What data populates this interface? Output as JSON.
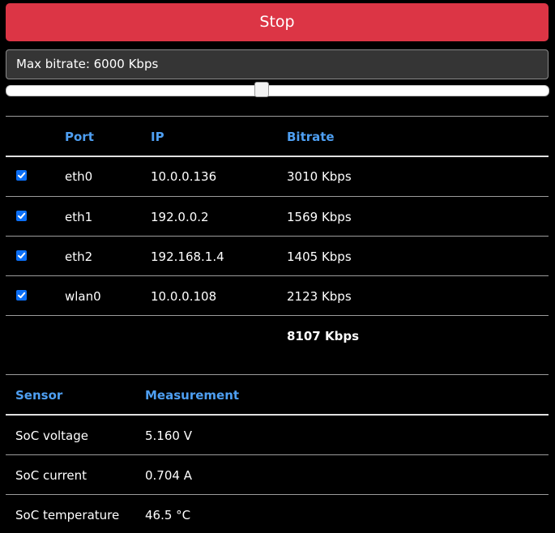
{
  "controls": {
    "stop_label": "Stop",
    "max_bitrate_label": "Max bitrate: 6000 Kbps",
    "slider_level_fraction": 0.47
  },
  "network_table": {
    "headers": {
      "port": "Port",
      "ip": "IP",
      "bitrate": "Bitrate"
    },
    "rows": [
      {
        "checked": true,
        "port": "eth0",
        "ip": "10.0.0.136",
        "bitrate": "3010 Kbps"
      },
      {
        "checked": true,
        "port": "eth1",
        "ip": "192.0.0.2",
        "bitrate": "1569 Kbps"
      },
      {
        "checked": true,
        "port": "eth2",
        "ip": "192.168.1.4",
        "bitrate": "1405 Kbps"
      },
      {
        "checked": true,
        "port": "wlan0",
        "ip": "10.0.0.108",
        "bitrate": "2123 Kbps"
      }
    ],
    "total_bitrate": "8107 Kbps"
  },
  "sensor_table": {
    "headers": {
      "sensor": "Sensor",
      "measurement": "Measurement"
    },
    "rows": [
      {
        "sensor": "SoC voltage",
        "measurement": "5.160 V"
      },
      {
        "sensor": "SoC current",
        "measurement": "0.704 A"
      },
      {
        "sensor": "SoC temperature",
        "measurement": "46.5 °C"
      }
    ]
  },
  "colors": {
    "stop_button": "#dc3545",
    "header_text": "#4e9ff2",
    "checkbox": "#0b6ff7",
    "background": "#000000"
  }
}
